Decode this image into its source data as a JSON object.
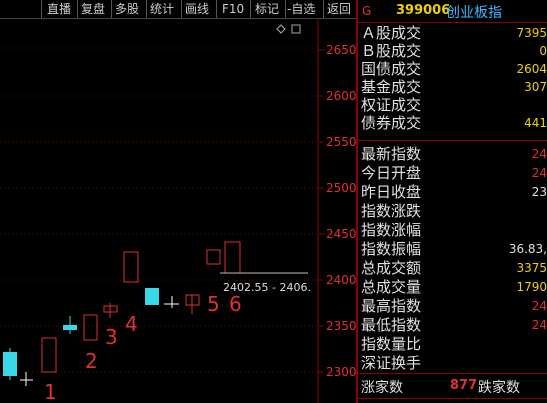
{
  "toolbar": {
    "items": [
      "直播",
      "复盘",
      "多股",
      "统计",
      "画线",
      "F10",
      "标记",
      "-自选",
      "返回"
    ]
  },
  "chart": {
    "price_axis_labels": [
      "2650",
      "2600",
      "2550",
      "2500",
      "2450",
      "2400",
      "2350",
      "2300"
    ],
    "range_label": "2402.55 - 2406.",
    "candle_numbers": [
      "1",
      "2",
      "3",
      "4",
      "5",
      "6"
    ]
  },
  "quote": {
    "badge": "G",
    "code": "399006",
    "name": "创业板指",
    "rows": [
      {
        "label": "Ａ股成交",
        "value": "7395",
        "color": "#f0d000"
      },
      {
        "label": "Ｂ股成交",
        "value": "0",
        "color": "#f0d000"
      },
      {
        "label": "国债成交",
        "value": "2604",
        "color": "#f0d000"
      },
      {
        "label": "基金成交",
        "value": "307",
        "color": "#f0d000"
      },
      {
        "label": "权证成交",
        "value": "",
        "color": "#f0d000"
      },
      {
        "label": "债券成交",
        "value": "441",
        "color": "#f0d000"
      }
    ],
    "rows2": [
      {
        "label": "最新指数",
        "value": "24",
        "color": "#e03030"
      },
      {
        "label": "今日开盘",
        "value": "24",
        "color": "#e03030"
      },
      {
        "label": "昨日收盘",
        "value": "23",
        "color": "#e0e0e0"
      },
      {
        "label": "指数涨跌",
        "value": "",
        "color": "#e03030"
      },
      {
        "label": "指数涨幅",
        "value": "",
        "color": "#e03030"
      },
      {
        "label": "指数振幅",
        "value": "36.83,",
        "color": "#e0e0e0"
      },
      {
        "label": "总成交额",
        "value": "3375",
        "color": "#f0d000"
      },
      {
        "label": "总成交量",
        "value": "1790",
        "color": "#f0d000"
      },
      {
        "label": "最高指数",
        "value": "24",
        "color": "#e03030"
      },
      {
        "label": "最低指数",
        "value": "24",
        "color": "#e03030"
      },
      {
        "label": "指数量比",
        "value": "",
        "color": "#e0e0e0"
      },
      {
        "label": "深证换手",
        "value": "",
        "color": "#e0e0e0"
      }
    ],
    "footer": {
      "up_label": "涨家数",
      "up_value": "877",
      "down_label": "跌家数"
    }
  },
  "colors": {
    "up": "#e03030",
    "down": "#39d8e8",
    "flat": "#ffffff"
  }
}
